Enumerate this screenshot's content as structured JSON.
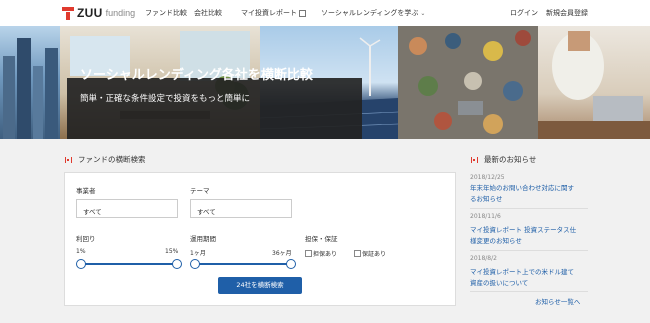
{
  "logo": {
    "brand": "ZUU",
    "sub": "funding"
  },
  "nav": {
    "fund_compare": "ファンド比較",
    "company_compare": "会社比較",
    "report": "マイ投資レポート",
    "learn": "ソーシャルレンディングを学ぶ",
    "login": "ログイン",
    "register": "新規会員登録"
  },
  "hero": {
    "title": "ソーシャルレンディング各社を横断比較",
    "subtitle": "簡単・正確な条件設定で投資をもっと簡単に"
  },
  "search": {
    "heading": "ファンドの横断検索",
    "operator_label": "事業者",
    "operator_value": "すべて",
    "theme_label": "テーマ",
    "theme_value": "すべて",
    "yield_label": "利回り",
    "yield_min": "1%",
    "yield_max": "15%",
    "period_label": "運用期間",
    "period_min": "1ヶ月",
    "period_max": "36ヶ月",
    "collateral_label": "担保・保証",
    "collateral_option": "担保あり",
    "guarantee_option": "保証あり",
    "button": "24社を横断検索"
  },
  "news": {
    "heading": "最新のお知らせ",
    "items": [
      {
        "date": "2018/12/25",
        "line1": "年末年始のお問い合わせ対応に関す",
        "line2": "るお知らせ"
      },
      {
        "date": "2018/11/6",
        "line1": "マイ投資レポート 投資ステータス仕",
        "line2": "様変更のお知らせ"
      },
      {
        "date": "2018/8/2",
        "line1": "マイ投資レポート上での米ドル建て",
        "line2": "資産の扱いについて"
      }
    ],
    "more": "お知らせ一覧へ"
  },
  "colors": {
    "accent": "#e03a2e",
    "primary": "#1f5fa8",
    "hero_overlay": "#232323"
  }
}
